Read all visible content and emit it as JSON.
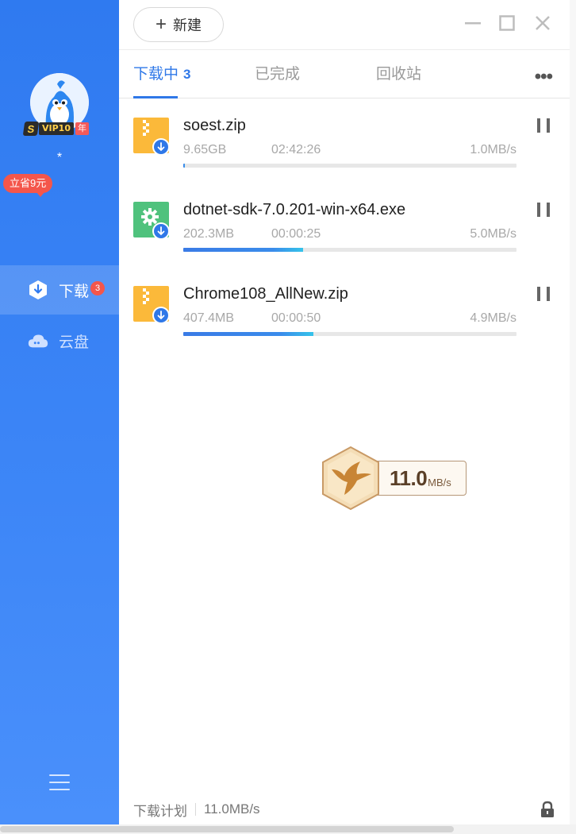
{
  "sidebar": {
    "username": "*",
    "vip": {
      "s_label": "S",
      "label": "VIP10",
      "year_label": "年"
    },
    "promo_label": "立省9元",
    "nav": [
      {
        "label": "下载",
        "badge": "3",
        "icon": "download-icon"
      },
      {
        "label": "云盘",
        "icon": "cloud-icon"
      }
    ],
    "menu_icon": "hamburger-menu-icon"
  },
  "toolbar": {
    "new_label": "新建",
    "window_controls": [
      "minimize-icon",
      "maximize-icon",
      "close-icon"
    ]
  },
  "tabs": [
    {
      "label": "下载中",
      "count": "3"
    },
    {
      "label": "已完成"
    },
    {
      "label": "回收站"
    }
  ],
  "more_label": "•••",
  "downloads": [
    {
      "name": "soest.zip",
      "size": "9.65GB",
      "time": "02:42:26",
      "speed": "1.0MB/s",
      "progress": 0.005,
      "type": "zip"
    },
    {
      "name": "dotnet-sdk-7.0.201-win-x64.exe",
      "size": "202.3MB",
      "time": "00:00:25",
      "speed": "5.0MB/s",
      "progress": 0.36,
      "type": "exe"
    },
    {
      "name": "Chrome108_AllNew.zip",
      "size": "407.4MB",
      "time": "00:00:50",
      "speed": "4.9MB/s",
      "progress": 0.39,
      "type": "zip"
    }
  ],
  "speed_widget": {
    "value": "11.0",
    "unit": "MB/s"
  },
  "footer": {
    "plan_label": "下载计划",
    "speed": "11.0MB/s"
  },
  "colors": {
    "accent": "#2f78e8",
    "sidebar_top": "#2f7af0",
    "badge_red": "#f4564b",
    "zip_yellow": "#fbb93a",
    "exe_green": "#4fc27d"
  }
}
